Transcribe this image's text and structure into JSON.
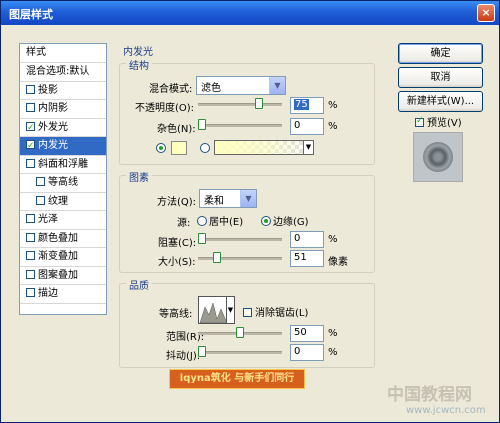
{
  "window": {
    "title": "图层样式",
    "close": "×"
  },
  "left_panel": {
    "header": "样式",
    "items": [
      {
        "label": "混合选项:默认",
        "has_checkbox": false,
        "checked": false,
        "selected": false,
        "indent": false
      },
      {
        "label": "投影",
        "has_checkbox": true,
        "checked": false,
        "selected": false,
        "indent": false
      },
      {
        "label": "内阴影",
        "has_checkbox": true,
        "checked": false,
        "selected": false,
        "indent": false
      },
      {
        "label": "外发光",
        "has_checkbox": true,
        "checked": true,
        "selected": false,
        "indent": false
      },
      {
        "label": "内发光",
        "has_checkbox": true,
        "checked": true,
        "selected": true,
        "indent": false
      },
      {
        "label": "斜面和浮雕",
        "has_checkbox": true,
        "checked": false,
        "selected": false,
        "indent": false
      },
      {
        "label": "等高线",
        "has_checkbox": true,
        "checked": false,
        "selected": false,
        "indent": true
      },
      {
        "label": "纹理",
        "has_checkbox": true,
        "checked": false,
        "selected": false,
        "indent": true
      },
      {
        "label": "光泽",
        "has_checkbox": true,
        "checked": false,
        "selected": false,
        "indent": false
      },
      {
        "label": "颜色叠加",
        "has_checkbox": true,
        "checked": false,
        "selected": false,
        "indent": false
      },
      {
        "label": "渐变叠加",
        "has_checkbox": true,
        "checked": false,
        "selected": false,
        "indent": false
      },
      {
        "label": "图案叠加",
        "has_checkbox": true,
        "checked": false,
        "selected": false,
        "indent": false
      },
      {
        "label": "描边",
        "has_checkbox": true,
        "checked": false,
        "selected": false,
        "indent": false
      }
    ]
  },
  "inner_glow": {
    "title": "内发光",
    "structure": {
      "legend": "结构",
      "blend_mode_label": "混合模式:",
      "blend_mode_value": "滤色",
      "opacity_label": "不透明度(O):",
      "opacity_value": "75",
      "opacity_unit": "%",
      "opacity_level": 0.75,
      "noise_label": "杂色(N):",
      "noise_value": "0",
      "noise_unit": "%",
      "noise_level": 0
    },
    "elements": {
      "legend": "图素",
      "method_label": "方法(Q):",
      "method_value": "柔和",
      "source_label": "源:",
      "source_center": "居中(E)",
      "source_edge": "边缘(G)",
      "choke_label": "阻塞(C):",
      "choke_value": "0",
      "choke_unit": "%",
      "choke_level": 0,
      "size_label": "大小(S):",
      "size_value": "51",
      "size_unit": "像素",
      "size_level": 0.2
    },
    "quality": {
      "legend": "品质",
      "contour_label": "等高线:",
      "antialias_label": "消除锯齿(L)",
      "range_label": "范围(R):",
      "range_value": "50",
      "range_unit": "%",
      "range_level": 0.5,
      "jitter_label": "抖动(J):",
      "jitter_value": "0",
      "jitter_unit": "%",
      "jitter_level": 0
    }
  },
  "buttons": {
    "ok": "确定",
    "cancel": "取消",
    "new_style": "新建样式(W)...",
    "preview": "预览(V)"
  },
  "watermark": {
    "text": "lqyna筑化 与新手们同行",
    "site": "中国教程网",
    "url": "www.jcwcn.com"
  },
  "colors": {
    "glow": "#FFFFBE",
    "selection": "#316AC5",
    "titlebar": "#1F5FD8"
  }
}
